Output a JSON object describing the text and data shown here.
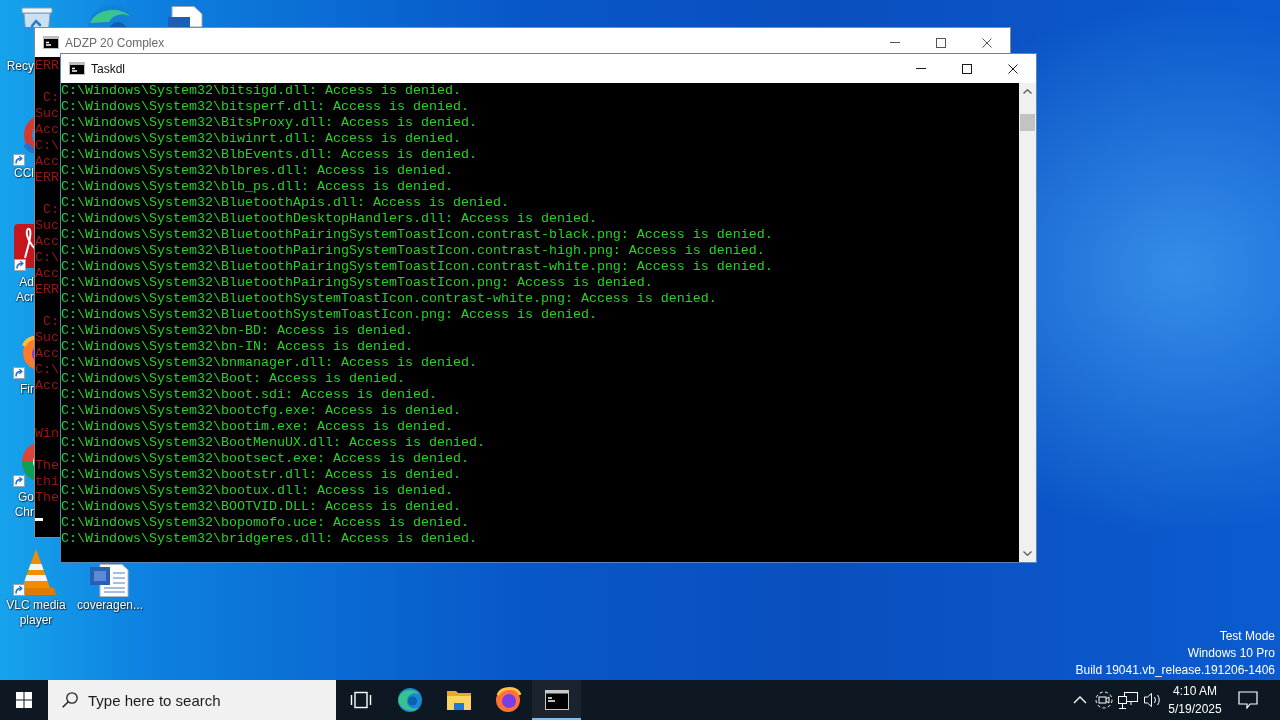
{
  "desktop_icons": [
    {
      "kind": "recycle-bin",
      "label": "Recy"
    },
    {
      "kind": "browser"
    },
    {
      "kind": "document"
    },
    {
      "kind": "cleaner",
      "label": "CCl"
    },
    {
      "kind": "pdf-reader",
      "label": "Ad\nAcr"
    },
    {
      "kind": "firefox",
      "label": "Fir"
    },
    {
      "kind": "chrome",
      "label": "Go\nChr"
    },
    {
      "kind": "media-player",
      "label": "VLC media player"
    },
    {
      "kind": "word-document",
      "label": "coveragen..."
    }
  ],
  "windows": [
    {
      "title": "ADZP 20 Complex",
      "active": false,
      "cursor": true,
      "blocks": [
        [
          "ERR"
        ],
        [
          " C:",
          "Suc",
          "Acc",
          "C:\\",
          "Acc",
          "ERR"
        ],
        [
          " C:",
          "Suc",
          "Acc",
          "C:\\",
          "Acc",
          "ERR"
        ],
        [
          " C:",
          "Suc",
          "Acc",
          "C:\\",
          "Acc"
        ],
        [
          "Win"
        ],
        [
          "The",
          "thi",
          "The"
        ]
      ]
    },
    {
      "title": "Taskdl",
      "active": true,
      "scrollbar": true,
      "lines": [
        "C:\\Windows\\System32\\bitsigd.dll: Access is denied.",
        "C:\\Windows\\System32\\bitsperf.dll: Access is denied.",
        "C:\\Windows\\System32\\BitsProxy.dll: Access is denied.",
        "C:\\Windows\\System32\\biwinrt.dll: Access is denied.",
        "C:\\Windows\\System32\\BlbEvents.dll: Access is denied.",
        "C:\\Windows\\System32\\blbres.dll: Access is denied.",
        "C:\\Windows\\System32\\blb_ps.dll: Access is denied.",
        "C:\\Windows\\System32\\BluetoothApis.dll: Access is denied.",
        "C:\\Windows\\System32\\BluetoothDesktopHandlers.dll: Access is denied.",
        "C:\\Windows\\System32\\BluetoothPairingSystemToastIcon.contrast-black.png: Access is denied.",
        "C:\\Windows\\System32\\BluetoothPairingSystemToastIcon.contrast-high.png: Access is denied.",
        "C:\\Windows\\System32\\BluetoothPairingSystemToastIcon.contrast-white.png: Access is denied.",
        "C:\\Windows\\System32\\BluetoothPairingSystemToastIcon.png: Access is denied.",
        "C:\\Windows\\System32\\BluetoothSystemToastIcon.contrast-white.png: Access is denied.",
        "C:\\Windows\\System32\\BluetoothSystemToastIcon.png: Access is denied.",
        "C:\\Windows\\System32\\bn-BD: Access is denied.",
        "C:\\Windows\\System32\\bn-IN: Access is denied.",
        "C:\\Windows\\System32\\bnmanager.dll: Access is denied.",
        "C:\\Windows\\System32\\Boot: Access is denied.",
        "C:\\Windows\\System32\\boot.sdi: Access is denied.",
        "C:\\Windows\\System32\\bootcfg.exe: Access is denied.",
        "C:\\Windows\\System32\\bootim.exe: Access is denied.",
        "C:\\Windows\\System32\\BootMenuUX.dll: Access is denied.",
        "C:\\Windows\\System32\\bootsect.exe: Access is denied.",
        "C:\\Windows\\System32\\bootstr.dll: Access is denied.",
        "C:\\Windows\\System32\\bootux.dll: Access is denied.",
        "C:\\Windows\\System32\\BOOTVID.DLL: Access is denied.",
        "C:\\Windows\\System32\\bopomofo.uce: Access is denied.",
        "C:\\Windows\\System32\\bridgeres.dll: Access is denied."
      ]
    }
  ],
  "system_info": [
    "Test Mode",
    "Windows 10 Pro",
    "Build 19041.vb_release.191206-1406"
  ],
  "taskbar": {
    "search": {
      "placeholder": "Type here to search"
    },
    "apps": [
      {
        "kind": "task-view",
        "running": false
      },
      {
        "kind": "edge",
        "running": false
      },
      {
        "kind": "file-explorer",
        "running": false
      },
      {
        "kind": "firefox",
        "running": false
      },
      {
        "kind": "terminal",
        "running": true
      }
    ],
    "clock": {
      "time": "4:10 AM",
      "date": "5/19/2025"
    }
  }
}
